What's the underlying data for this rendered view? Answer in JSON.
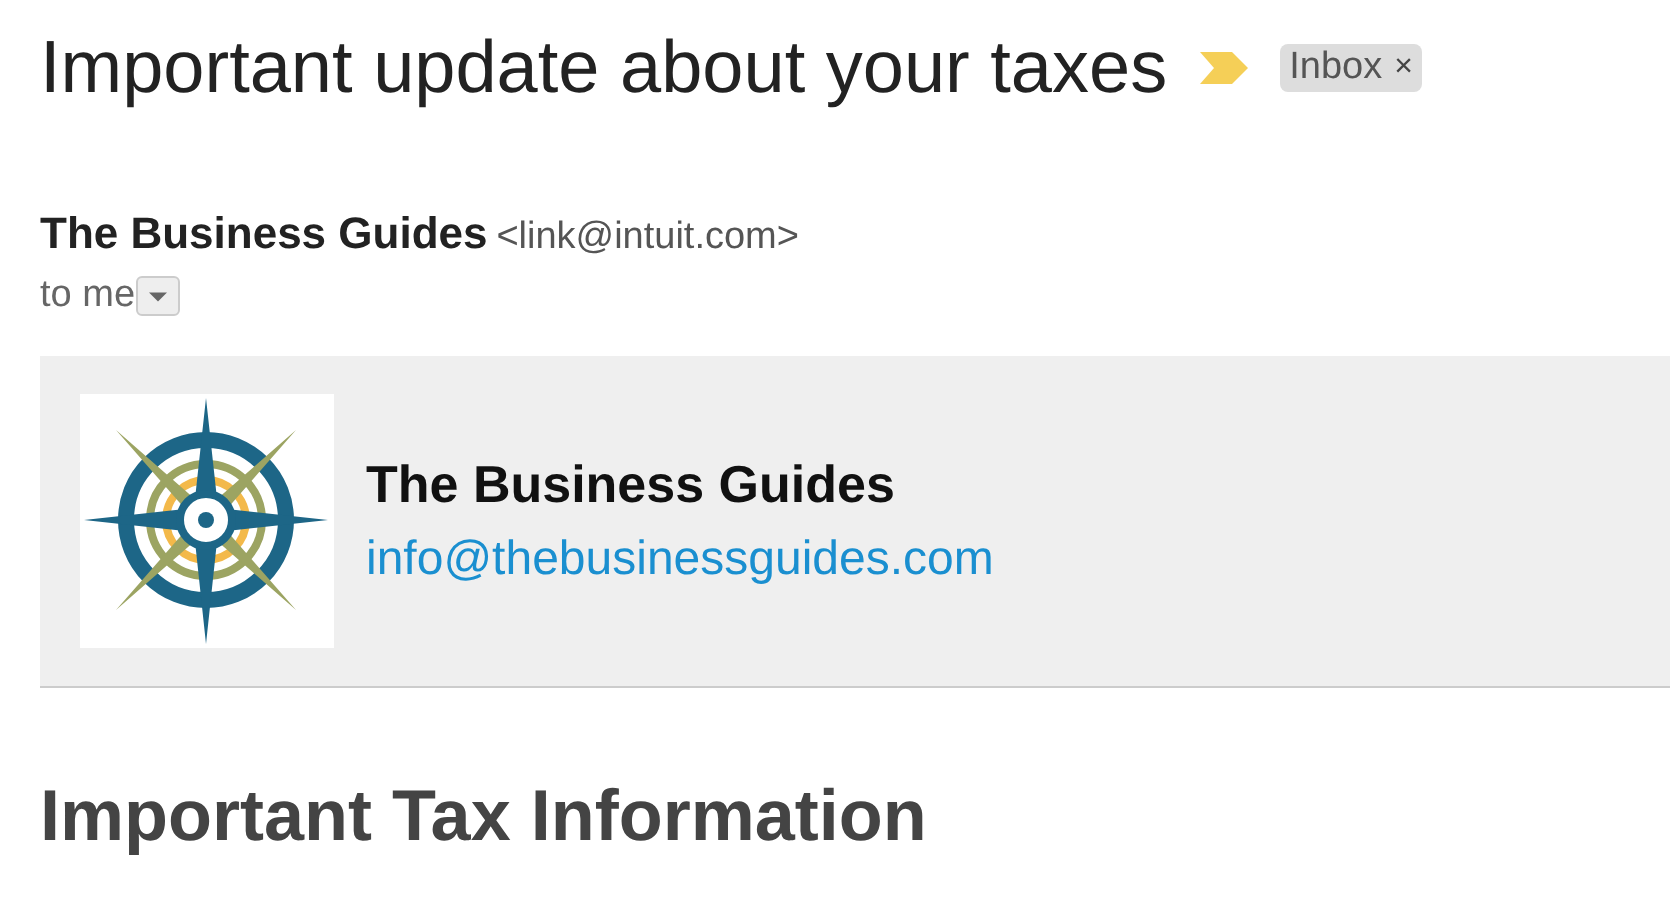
{
  "subject": "Important update about your taxes",
  "labels": [
    {
      "text": "Inbox",
      "close": "×"
    }
  ],
  "sender": {
    "name": "The Business Guides",
    "email": "<link@intuit.com>",
    "recipient": "to me"
  },
  "banner": {
    "name": "The Business Guides",
    "email": "info@thebusinessguides.com"
  },
  "body": {
    "heading": "Important Tax Information"
  }
}
